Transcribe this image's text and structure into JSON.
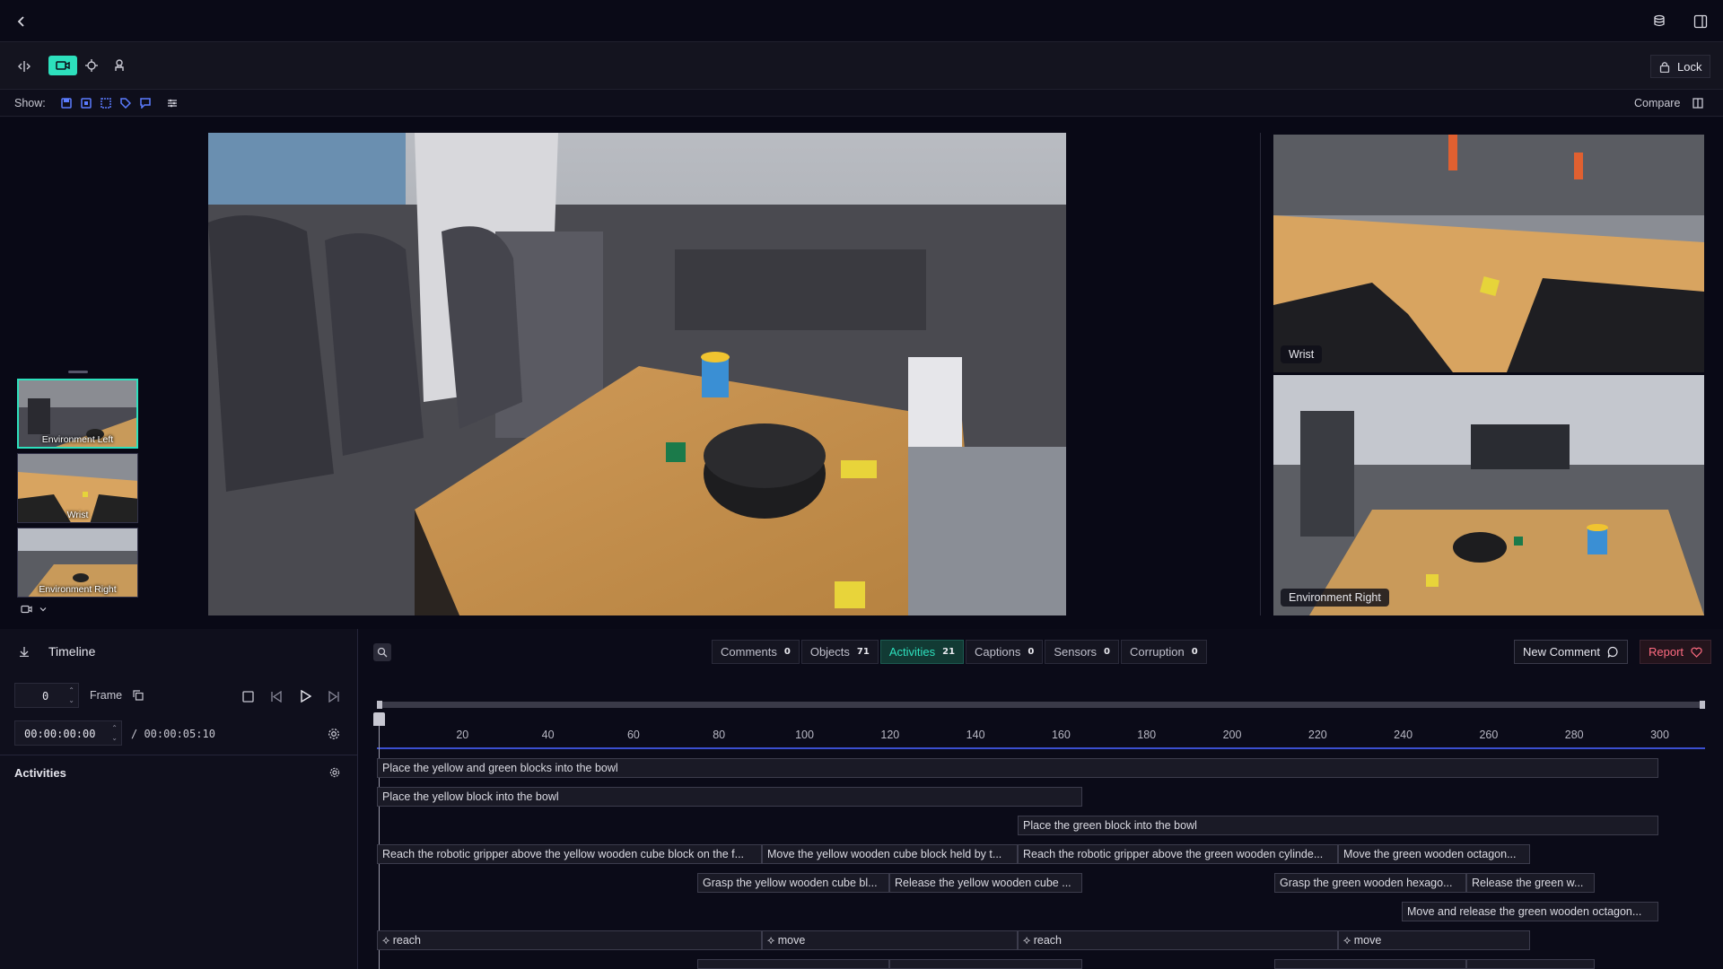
{
  "toolbar": {
    "lock_label": "Lock"
  },
  "show": {
    "label": "Show:",
    "compare_label": "Compare"
  },
  "cameras": {
    "thumbnails": [
      "Environment Left",
      "Wrist",
      "Environment Right"
    ],
    "wrist_label": "Wrist",
    "right_label": "Environment Right"
  },
  "timeline": {
    "title": "Timeline",
    "frame_value": "0",
    "frame_label": "Frame",
    "time_value": "00:00:00:00",
    "duration": "/ 00:00:05:10",
    "activities_title": "Activities"
  },
  "tabs": [
    {
      "label": "Comments",
      "count": "0"
    },
    {
      "label": "Objects",
      "count": "71"
    },
    {
      "label": "Activities",
      "count": "21"
    },
    {
      "label": "Captions",
      "count": "0"
    },
    {
      "label": "Sensors",
      "count": "0"
    },
    {
      "label": "Corruption",
      "count": "0"
    }
  ],
  "actions": {
    "new_comment": "New Comment",
    "report": "Report"
  },
  "ruler": {
    "ticks": [
      "20",
      "40",
      "60",
      "80",
      "100",
      "120",
      "140",
      "160",
      "180",
      "200",
      "220",
      "240",
      "260",
      "280",
      "300"
    ]
  },
  "activities": {
    "row1": [
      "Place the yellow and green blocks into the bowl"
    ],
    "row2": [
      "Place the yellow block into the bowl"
    ],
    "row3": [
      "Place the green block into the bowl"
    ],
    "row4": [
      "Reach the robotic gripper above the yellow wooden cube block on the f...",
      "Move the yellow wooden cube block held by t...",
      "Reach the robotic gripper above the green wooden cylinde...",
      "Move the green wooden octagon..."
    ],
    "row5": [
      "Grasp the yellow wooden cube bl...",
      "Release the yellow wooden cube ...",
      "Grasp the green wooden hexago...",
      "Release the green w..."
    ],
    "row6": [
      "Move and release the green wooden octagon..."
    ],
    "row7": [
      "⟡ reach",
      "⟡ move",
      "⟡ reach",
      "⟡ move"
    ]
  },
  "colors": {
    "accent": "#2de0bd",
    "report": "#ff6b81",
    "ruler": "#3b4fd0"
  }
}
